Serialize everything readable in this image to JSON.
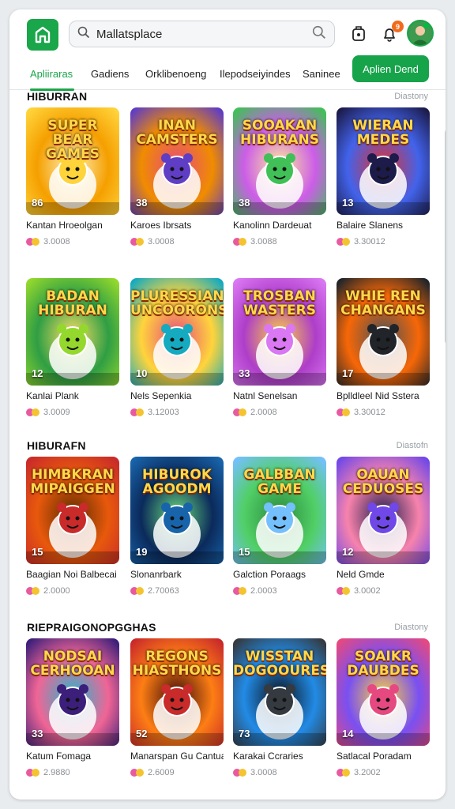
{
  "header": {
    "logo_icon": "store-logo-icon",
    "search": {
      "value": "Mallatsplace",
      "placeholder": "Mallatsplace"
    },
    "notification_count": "9",
    "icons": [
      "search-icon",
      "wallet-icon",
      "notification-bell-icon",
      "avatar"
    ]
  },
  "tabs": [
    {
      "label": "Apliiraras",
      "active": true
    },
    {
      "label": "Gadiens"
    },
    {
      "label": "Orklibenoeng"
    },
    {
      "label": "Ilepodseiyindes"
    },
    {
      "label": "Saninee"
    }
  ],
  "cta_label": "Aplien Dend",
  "colors": {
    "accent": "#16a34a",
    "badge": "#f26b1d"
  },
  "sections": [
    {
      "title": "HIBURRAN",
      "link": "Diastony",
      "rows": [
        [
          {
            "art_title": "SUPER BEAR\nGAMES",
            "badge": "86",
            "name": "Kantan Hroeolgan",
            "meta": "3.0008",
            "theme": "yellow"
          },
          {
            "art_title": "INAN\nCAMSTERS",
            "badge": "38",
            "name": "Karoes Ibrsats",
            "meta": "3.0008",
            "theme": "purple"
          },
          {
            "art_title": "SOOAKAN\nHIBURANS",
            "badge": "38",
            "name": "Kanolinn Dardeuat",
            "meta": "3.0088",
            "theme": "green"
          },
          {
            "art_title": "WIERAN\nMEDES",
            "badge": "13",
            "name": "Balaire Slanens",
            "meta": "3.30012",
            "theme": "blue"
          }
        ],
        [
          {
            "art_title": "BADAN\nHIBURAN",
            "badge": "12",
            "name": "Kanlai Plank",
            "meta": "3.0009",
            "theme": "lime"
          },
          {
            "art_title": "PLURESSIAN\nUNCOORONS",
            "badge": "10",
            "name": "Nels Sepenkia",
            "meta": "3.12003",
            "theme": "teal"
          },
          {
            "art_title": "TROSBAN\nWASTERS",
            "badge": "33",
            "name": "Natnl Senelsan",
            "meta": "2.0008",
            "theme": "pink"
          },
          {
            "art_title": "WHIE REN\nCHANGANS",
            "badge": "17",
            "name": "Bplldleel Nid Sstera",
            "meta": "3.30012",
            "theme": "dark"
          }
        ]
      ]
    },
    {
      "title": "HIBURAFN",
      "link": "Diastofn",
      "rows": [
        [
          {
            "art_title": "HIMBKRAN\nMIPAIGGEN",
            "badge": "15",
            "name": "Baagian Noi Balbecai",
            "meta": "2.0000",
            "theme": "red"
          },
          {
            "art_title": "HIBUROK\nAGOODM",
            "badge": "19",
            "name": "Slonanrbark",
            "meta": "2.70063",
            "theme": "navy"
          },
          {
            "art_title": "GALBBAN\nGAME",
            "badge": "15",
            "name": "Galction Poraags",
            "meta": "2.0003",
            "theme": "sky"
          },
          {
            "art_title": "OAUAN\nCEDUOSES",
            "badge": "12",
            "name": "Neld Gmde",
            "meta": "3.0002",
            "theme": "violet"
          }
        ]
      ]
    },
    {
      "title": "RIEPRAIGONOPGGHAS",
      "link": "Diastony",
      "rows": [
        [
          {
            "art_title": "NODSAI\nCERHOOAN",
            "badge": "33",
            "name": "Katum Fomaga",
            "meta": "2.9880",
            "theme": "neon"
          },
          {
            "art_title": "REGONS\nHIASTHONS",
            "badge": "52",
            "name": "Manarspan Gu Cantua",
            "meta": "2.6009",
            "theme": "fire"
          },
          {
            "art_title": "WISSTAN\nDOGOOURES",
            "badge": "73",
            "name": "Karakai Ccraries",
            "meta": "3.0008",
            "theme": "steel"
          },
          {
            "art_title": "SOAIKR\nDAUBDES",
            "badge": "14",
            "name": "Satlacal Poradam",
            "meta": "3.2002",
            "theme": "magenta"
          }
        ]
      ]
    }
  ]
}
